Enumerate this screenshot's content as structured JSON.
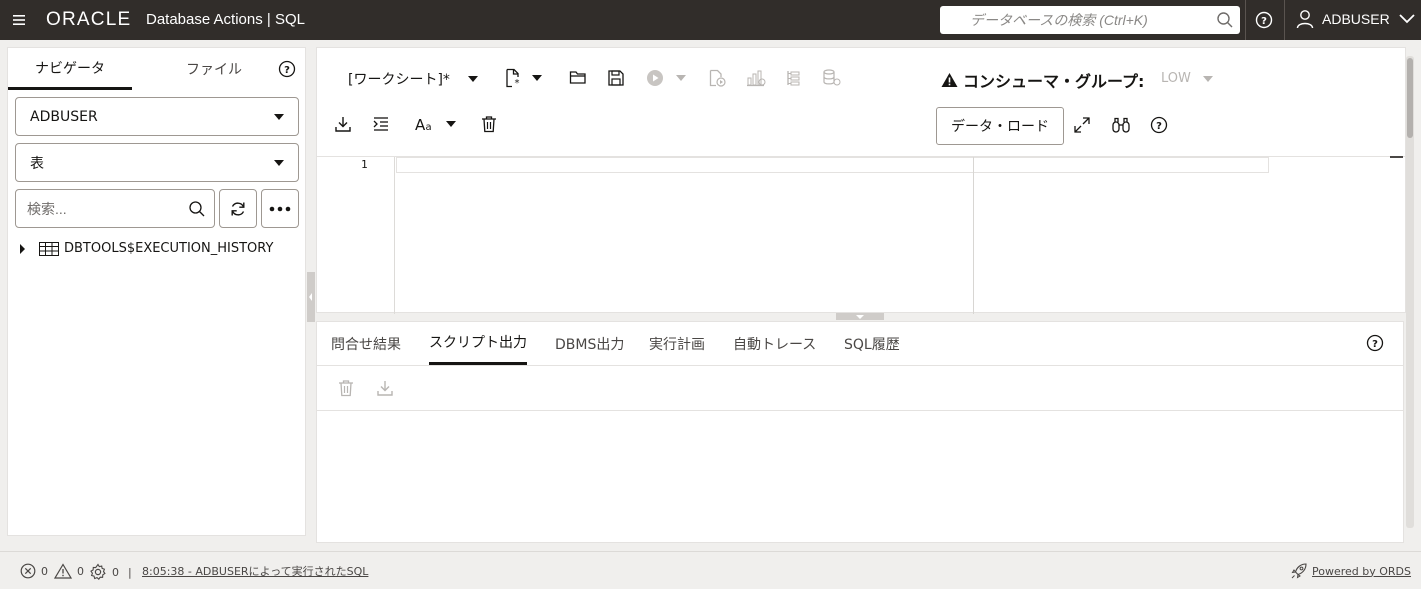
{
  "header": {
    "brand": "ORACLE",
    "app_title": "Database Actions |  SQL",
    "search_placeholder": "データベースの検索 (Ctrl+K)",
    "user": "ADBUSER"
  },
  "navigator": {
    "tabs": [
      {
        "label": "ナビゲータ",
        "active": true
      },
      {
        "label": "ファイル",
        "active": false
      }
    ],
    "schema_select": "ADBUSER",
    "object_type_select": "表",
    "search_placeholder": "検索...",
    "tree_items": [
      {
        "label": "DBTOOLS$EXECUTION_HISTORY",
        "icon": "table-icon"
      }
    ]
  },
  "editor": {
    "worksheet_label": "[ワークシート]*",
    "consumer_group_label": "コンシューマ・グループ:",
    "consumer_group_value": "LOW",
    "data_load_label": "データ・ロード",
    "line_numbers": [
      "1"
    ]
  },
  "output": {
    "tabs": [
      {
        "label": "問合せ結果",
        "active": false
      },
      {
        "label": "スクリプト出力",
        "active": true
      },
      {
        "label": "DBMS出力",
        "active": false
      },
      {
        "label": "実行計画",
        "active": false
      },
      {
        "label": "自動トレース",
        "active": false
      },
      {
        "label": "SQL履歴",
        "active": false
      }
    ]
  },
  "statusbar": {
    "errors": "0",
    "warnings": "0",
    "tasks": "0",
    "separator": "|",
    "last_execution": "8:05:38 - ADBUSERによって実行されたSQL",
    "powered_by": "Powered by ORDS"
  },
  "colors": {
    "header_bg": "#312d2a",
    "body_bg": "#f0efed",
    "panel_bg": "#ffffff",
    "text": "#161513",
    "warning": "#161513"
  }
}
